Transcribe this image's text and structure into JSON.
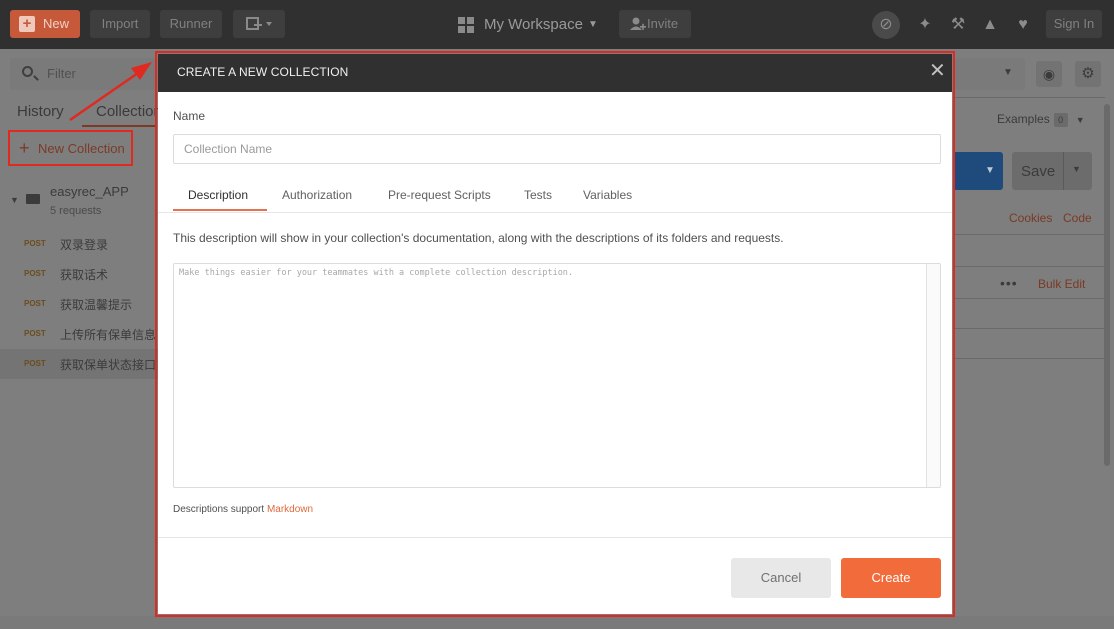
{
  "topbar": {
    "new_label": "New",
    "import_label": "Import",
    "runner_label": "Runner",
    "workspace_label": "My Workspace",
    "invite_label": "Invite",
    "signin_label": "Sign In"
  },
  "sidebar": {
    "filter_placeholder": "Filter",
    "tab_history": "History",
    "tab_collections": "Collections",
    "new_collection_label": "New Collection",
    "collection": {
      "name": "easyrec_APP",
      "count": "5 requests"
    },
    "requests": [
      {
        "method": "POST",
        "name": "双录登录"
      },
      {
        "method": "POST",
        "name": "获取话术"
      },
      {
        "method": "POST",
        "name": "获取温馨提示"
      },
      {
        "method": "POST",
        "name": "上传所有保单信息"
      },
      {
        "method": "POST",
        "name": "获取保单状态接口"
      }
    ]
  },
  "main": {
    "examples_label": "Examples",
    "examples_count": "0",
    "save_label": "Save",
    "cookies_label": "Cookies",
    "code_label": "Code",
    "bulk_edit_label": "Bulk Edit"
  },
  "modal": {
    "title": "CREATE A NEW COLLECTION",
    "name_label": "Name",
    "name_placeholder": "Collection Name",
    "tabs": [
      "Description",
      "Authorization",
      "Pre-request Scripts",
      "Tests",
      "Variables"
    ],
    "description_text": "This description will show in your collection's documentation, along with the descriptions of its folders and requests.",
    "description_placeholder": "Make things easier for your teammates with a complete collection description.",
    "markdown_note": "Descriptions support",
    "markdown_link": "Markdown",
    "cancel_label": "Cancel",
    "create_label": "Create"
  },
  "colors": {
    "accent": "#f26b3a",
    "topbar_bg": "#303030",
    "highlight_outline": "#e0291f"
  },
  "icons": {
    "new": "plus-icon",
    "workspace": "grid-icon",
    "invite": "add-user-icon",
    "sync": "sync-off-icon",
    "interceptor": "satellite-icon",
    "settings": "wrench-icon",
    "notifications": "bell-icon",
    "favorites": "heart-icon",
    "close": "close-icon"
  }
}
